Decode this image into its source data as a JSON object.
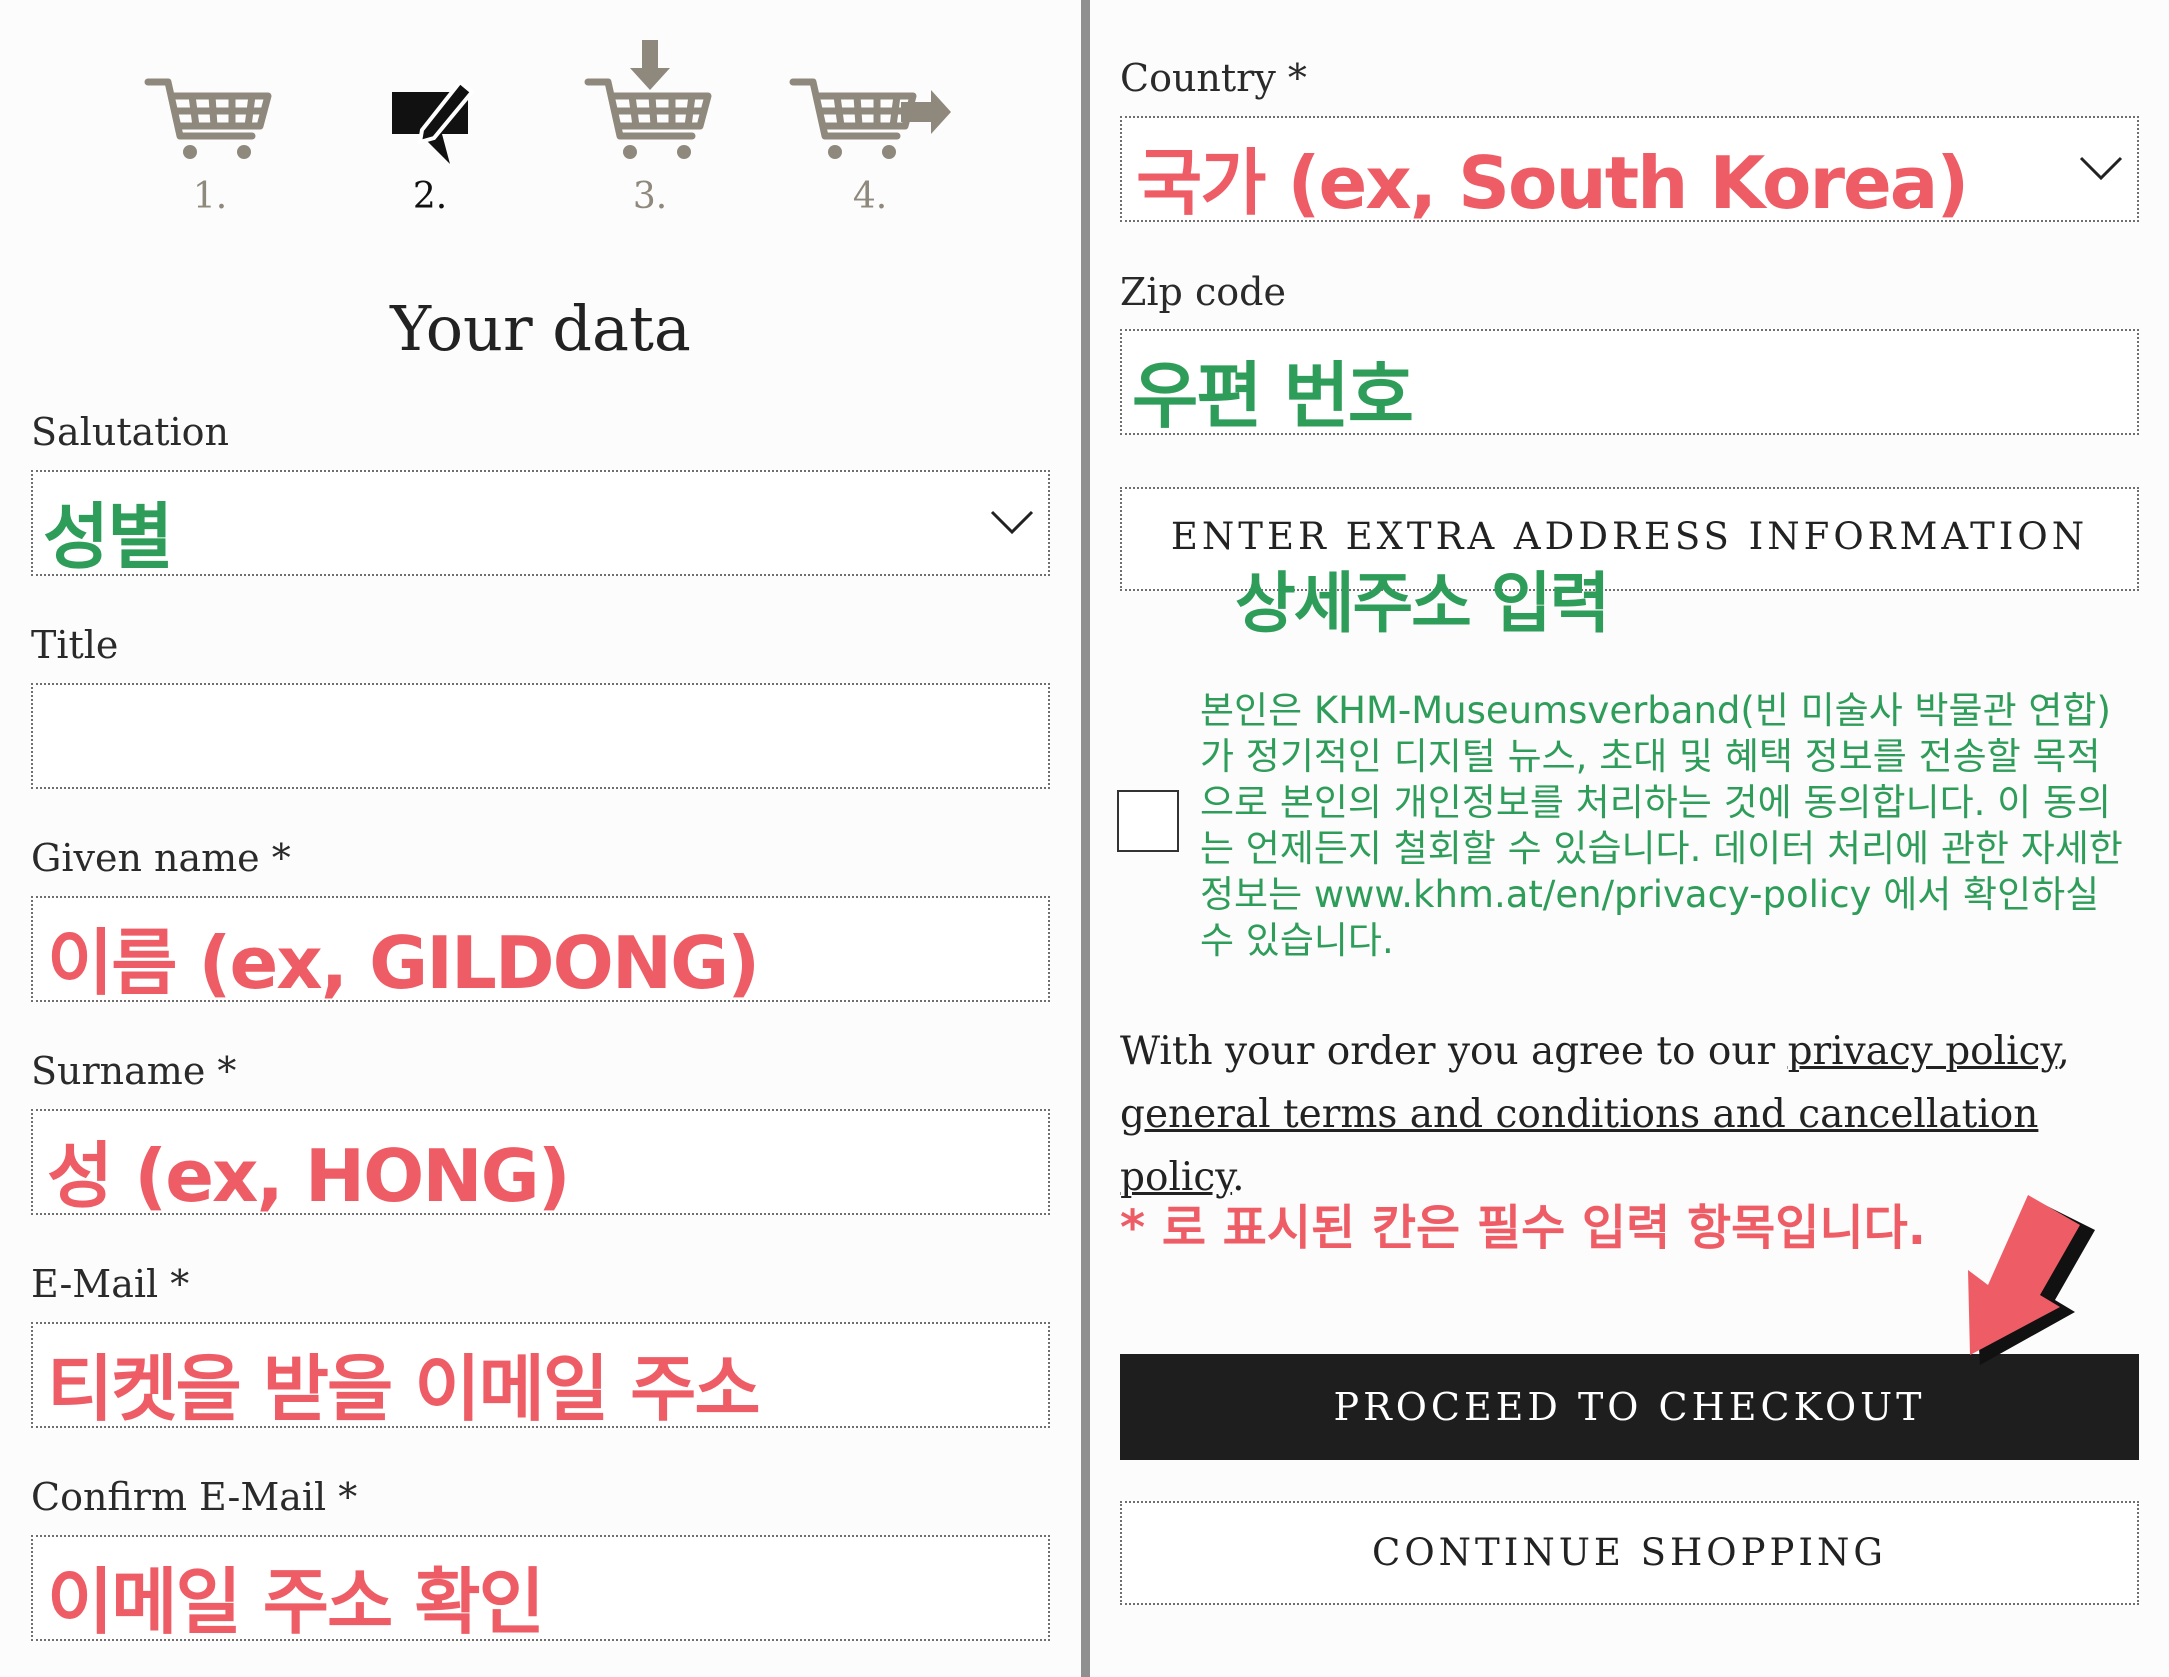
{
  "steps": [
    {
      "num": "1.",
      "icon": "shopping-cart-icon",
      "active": false
    },
    {
      "num": "2.",
      "icon": "edit-data-icon",
      "active": true
    },
    {
      "num": "3.",
      "icon": "cart-download-icon",
      "active": false
    },
    {
      "num": "4.",
      "icon": "cart-forward-icon",
      "active": false
    }
  ],
  "page_title": "Your data",
  "form": {
    "salutation": {
      "label": "Salutation",
      "annotation": "성별"
    },
    "title": {
      "label": "Title",
      "value": ""
    },
    "given_name": {
      "label": "Given name *",
      "annotation": "이름 (ex, GILDONG)"
    },
    "surname": {
      "label": "Surname *",
      "annotation": "성 (ex, HONG)"
    },
    "email": {
      "label": "E-Mail *",
      "annotation": "티켓을 받을 이메일 주소"
    },
    "confirm_email": {
      "label": "Confirm E-Mail *",
      "annotation": "이메일 주소 확인"
    },
    "country": {
      "label": "Country *",
      "annotation": "국가 (ex, South Korea)"
    },
    "zip": {
      "label": "Zip code",
      "annotation": "우편 번호"
    }
  },
  "extra_address": {
    "label": "ENTER EXTRA ADDRESS INFORMATION",
    "annotation": "상세주소 입력"
  },
  "consent": {
    "checked": false,
    "text": "본인은 KHM-Museumsverband(빈 미술사 박물관 연합)가 정기적인 디지털 뉴스, 초대 및 혜택 정보를 전송할 목적으로 본인의 개인정보를 처리하는 것에 동의합니다. 이 동의는 언제든지 철회할 수 있습니다. 데이터 처리에 관한 자세한 정보는 www.khm.at/en/privacy-policy 에서 확인하실 수 있습니다."
  },
  "agreement": {
    "prefix": "With your order you agree to our ",
    "privacy_link": "privacy policy",
    "separator": ", ",
    "terms_link": "general terms and conditions and cancellation policy",
    "suffix": "."
  },
  "required_note": "* 로 표시된 칸은 필수 입력 항목입니다.",
  "buttons": {
    "checkout": "PROCEED TO CHECKOUT",
    "continue": "CONTINUE SHOPPING"
  },
  "colors": {
    "annotation_red": "#ee5d66",
    "annotation_green": "#2f9d5a",
    "step_inactive": "#8f887c",
    "checkout_bg": "#1e1e1e"
  }
}
